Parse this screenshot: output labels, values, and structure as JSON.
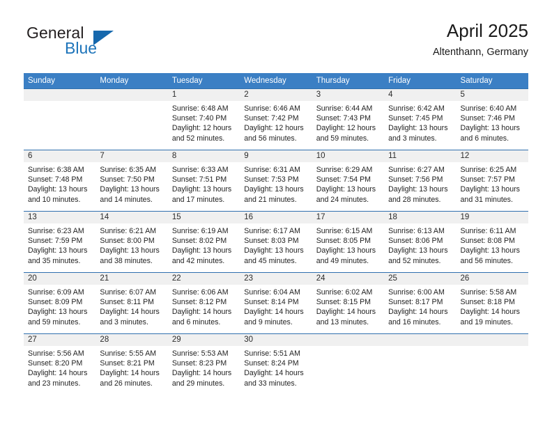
{
  "brand": {
    "word1": "General",
    "word2": "Blue",
    "logo_icon": "triangle-logo-icon",
    "colors": {
      "blue": "#1668ad",
      "dark": "#231f20"
    }
  },
  "header": {
    "title": "April 2025",
    "location": "Altenthann, Germany"
  },
  "calendar": {
    "accent_color": "#3b7fc4",
    "daynum_bg": "#f0f0f0",
    "weekday_headers": [
      "Sunday",
      "Monday",
      "Tuesday",
      "Wednesday",
      "Thursday",
      "Friday",
      "Saturday"
    ],
    "weeks": [
      [
        {
          "day": "",
          "empty": true
        },
        {
          "day": "",
          "empty": true
        },
        {
          "day": "1",
          "sunrise": "Sunrise: 6:48 AM",
          "sunset": "Sunset: 7:40 PM",
          "daylight": "Daylight: 12 hours and 52 minutes."
        },
        {
          "day": "2",
          "sunrise": "Sunrise: 6:46 AM",
          "sunset": "Sunset: 7:42 PM",
          "daylight": "Daylight: 12 hours and 56 minutes."
        },
        {
          "day": "3",
          "sunrise": "Sunrise: 6:44 AM",
          "sunset": "Sunset: 7:43 PM",
          "daylight": "Daylight: 12 hours and 59 minutes."
        },
        {
          "day": "4",
          "sunrise": "Sunrise: 6:42 AM",
          "sunset": "Sunset: 7:45 PM",
          "daylight": "Daylight: 13 hours and 3 minutes."
        },
        {
          "day": "5",
          "sunrise": "Sunrise: 6:40 AM",
          "sunset": "Sunset: 7:46 PM",
          "daylight": "Daylight: 13 hours and 6 minutes."
        }
      ],
      [
        {
          "day": "6",
          "sunrise": "Sunrise: 6:38 AM",
          "sunset": "Sunset: 7:48 PM",
          "daylight": "Daylight: 13 hours and 10 minutes."
        },
        {
          "day": "7",
          "sunrise": "Sunrise: 6:35 AM",
          "sunset": "Sunset: 7:50 PM",
          "daylight": "Daylight: 13 hours and 14 minutes."
        },
        {
          "day": "8",
          "sunrise": "Sunrise: 6:33 AM",
          "sunset": "Sunset: 7:51 PM",
          "daylight": "Daylight: 13 hours and 17 minutes."
        },
        {
          "day": "9",
          "sunrise": "Sunrise: 6:31 AM",
          "sunset": "Sunset: 7:53 PM",
          "daylight": "Daylight: 13 hours and 21 minutes."
        },
        {
          "day": "10",
          "sunrise": "Sunrise: 6:29 AM",
          "sunset": "Sunset: 7:54 PM",
          "daylight": "Daylight: 13 hours and 24 minutes."
        },
        {
          "day": "11",
          "sunrise": "Sunrise: 6:27 AM",
          "sunset": "Sunset: 7:56 PM",
          "daylight": "Daylight: 13 hours and 28 minutes."
        },
        {
          "day": "12",
          "sunrise": "Sunrise: 6:25 AM",
          "sunset": "Sunset: 7:57 PM",
          "daylight": "Daylight: 13 hours and 31 minutes."
        }
      ],
      [
        {
          "day": "13",
          "sunrise": "Sunrise: 6:23 AM",
          "sunset": "Sunset: 7:59 PM",
          "daylight": "Daylight: 13 hours and 35 minutes."
        },
        {
          "day": "14",
          "sunrise": "Sunrise: 6:21 AM",
          "sunset": "Sunset: 8:00 PM",
          "daylight": "Daylight: 13 hours and 38 minutes."
        },
        {
          "day": "15",
          "sunrise": "Sunrise: 6:19 AM",
          "sunset": "Sunset: 8:02 PM",
          "daylight": "Daylight: 13 hours and 42 minutes."
        },
        {
          "day": "16",
          "sunrise": "Sunrise: 6:17 AM",
          "sunset": "Sunset: 8:03 PM",
          "daylight": "Daylight: 13 hours and 45 minutes."
        },
        {
          "day": "17",
          "sunrise": "Sunrise: 6:15 AM",
          "sunset": "Sunset: 8:05 PM",
          "daylight": "Daylight: 13 hours and 49 minutes."
        },
        {
          "day": "18",
          "sunrise": "Sunrise: 6:13 AM",
          "sunset": "Sunset: 8:06 PM",
          "daylight": "Daylight: 13 hours and 52 minutes."
        },
        {
          "day": "19",
          "sunrise": "Sunrise: 6:11 AM",
          "sunset": "Sunset: 8:08 PM",
          "daylight": "Daylight: 13 hours and 56 minutes."
        }
      ],
      [
        {
          "day": "20",
          "sunrise": "Sunrise: 6:09 AM",
          "sunset": "Sunset: 8:09 PM",
          "daylight": "Daylight: 13 hours and 59 minutes."
        },
        {
          "day": "21",
          "sunrise": "Sunrise: 6:07 AM",
          "sunset": "Sunset: 8:11 PM",
          "daylight": "Daylight: 14 hours and 3 minutes."
        },
        {
          "day": "22",
          "sunrise": "Sunrise: 6:06 AM",
          "sunset": "Sunset: 8:12 PM",
          "daylight": "Daylight: 14 hours and 6 minutes."
        },
        {
          "day": "23",
          "sunrise": "Sunrise: 6:04 AM",
          "sunset": "Sunset: 8:14 PM",
          "daylight": "Daylight: 14 hours and 9 minutes."
        },
        {
          "day": "24",
          "sunrise": "Sunrise: 6:02 AM",
          "sunset": "Sunset: 8:15 PM",
          "daylight": "Daylight: 14 hours and 13 minutes."
        },
        {
          "day": "25",
          "sunrise": "Sunrise: 6:00 AM",
          "sunset": "Sunset: 8:17 PM",
          "daylight": "Daylight: 14 hours and 16 minutes."
        },
        {
          "day": "26",
          "sunrise": "Sunrise: 5:58 AM",
          "sunset": "Sunset: 8:18 PM",
          "daylight": "Daylight: 14 hours and 19 minutes."
        }
      ],
      [
        {
          "day": "27",
          "sunrise": "Sunrise: 5:56 AM",
          "sunset": "Sunset: 8:20 PM",
          "daylight": "Daylight: 14 hours and 23 minutes."
        },
        {
          "day": "28",
          "sunrise": "Sunrise: 5:55 AM",
          "sunset": "Sunset: 8:21 PM",
          "daylight": "Daylight: 14 hours and 26 minutes."
        },
        {
          "day": "29",
          "sunrise": "Sunrise: 5:53 AM",
          "sunset": "Sunset: 8:23 PM",
          "daylight": "Daylight: 14 hours and 29 minutes."
        },
        {
          "day": "30",
          "sunrise": "Sunrise: 5:51 AM",
          "sunset": "Sunset: 8:24 PM",
          "daylight": "Daylight: 14 hours and 33 minutes."
        },
        {
          "day": "",
          "empty": true
        },
        {
          "day": "",
          "empty": true
        },
        {
          "day": "",
          "empty": true
        }
      ]
    ]
  }
}
